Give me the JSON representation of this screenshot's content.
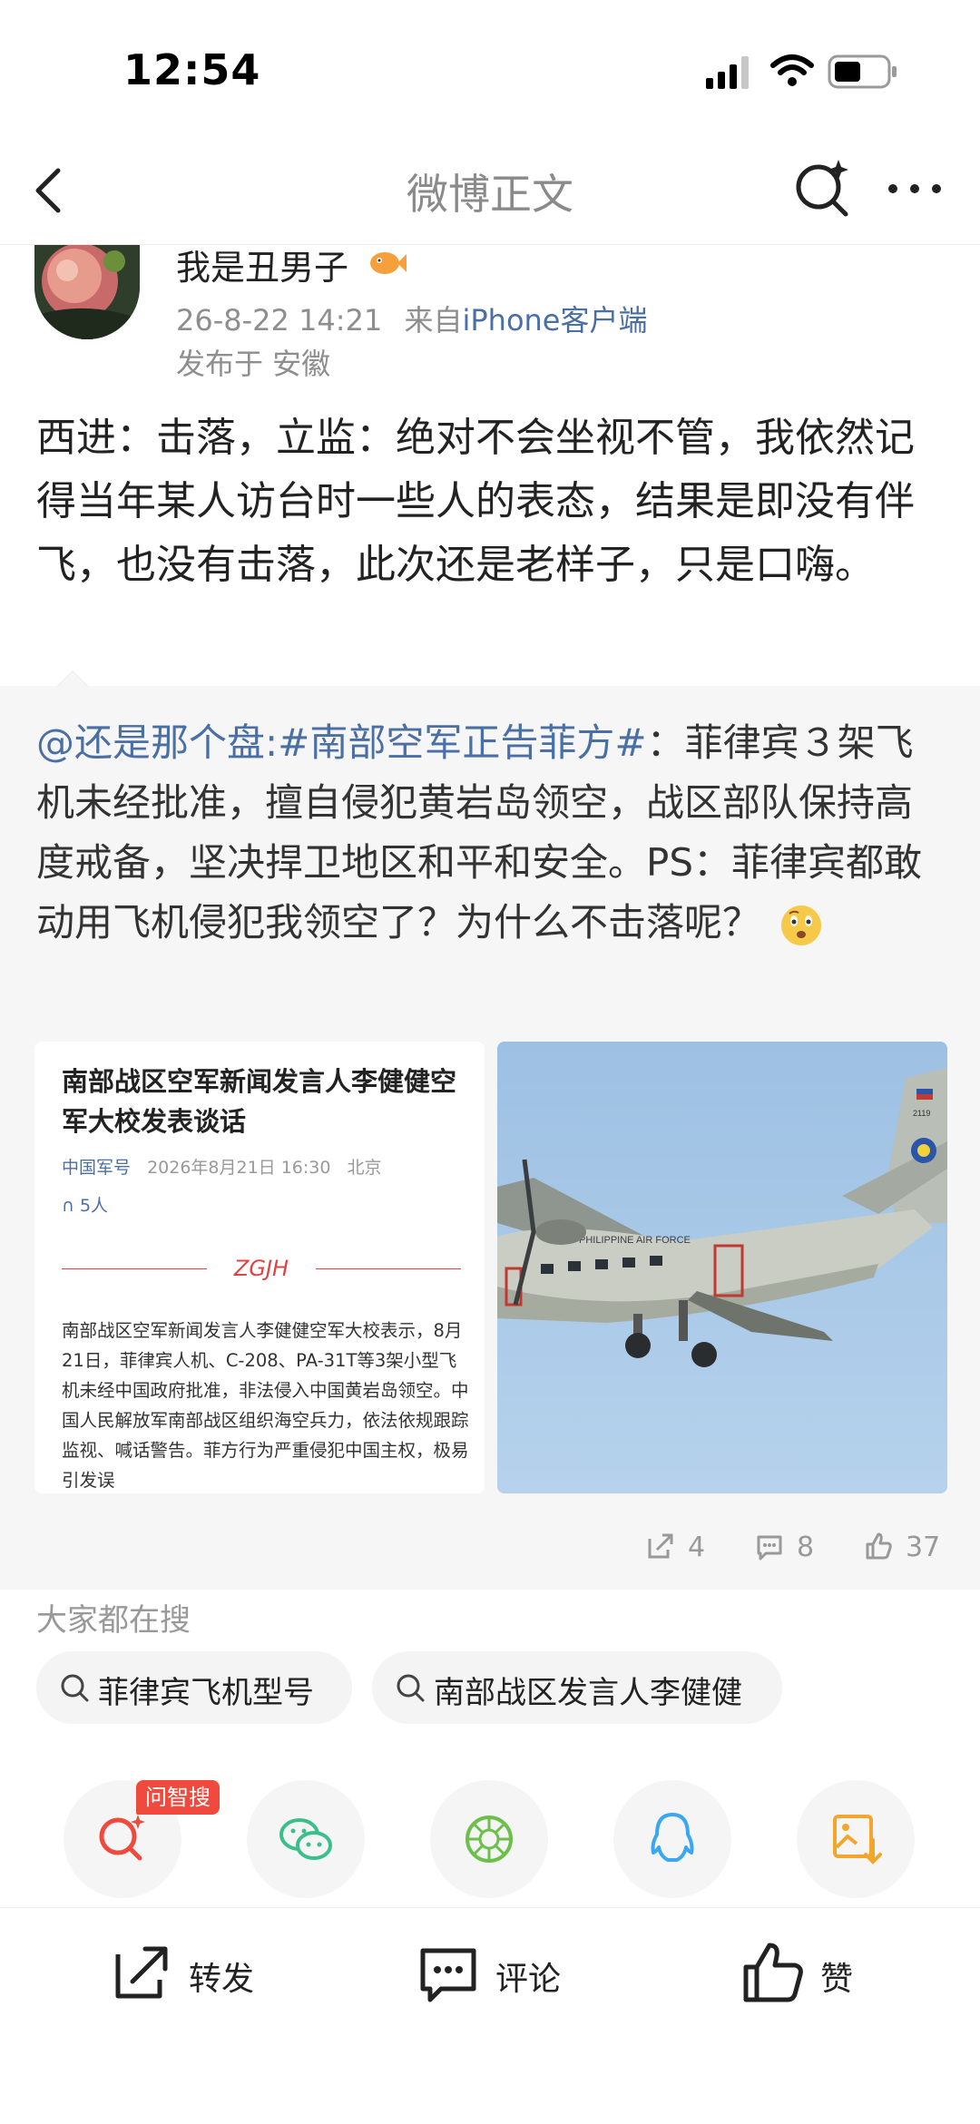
{
  "status_bar": {
    "time": "12:54"
  },
  "nav": {
    "title": "微博正文",
    "icons": [
      "back-arrow-icon",
      "search-sparkle-icon",
      "more-icon"
    ]
  },
  "author": {
    "name": "我是丑男子",
    "timestamp": "26-8-22 14:21",
    "source_prefix": "来自",
    "source": "iPhone客户端",
    "location": "发布于 安徽"
  },
  "post": {
    "text": "西进：击落，立监：绝对不会坐视不管，我依然记得当年某人访台时一些人的表态，结果是即没有伴飞，也没有击落，此次还是老样子，只是口嗨。"
  },
  "repost": {
    "user_link": "@还是那个盘",
    "separator": ":",
    "topic": "#南部空军正告菲方#",
    "text": "：菲律宾３架飞机未经批准，擅自侵犯黄岩岛领空，战区部队保持高度戒备，坚决捍卫地区和平和安全。PS：菲律宾都敢动用飞机侵犯我领空了？为什么不击落呢？",
    "emoji": "thinking-face-icon",
    "image_1": {
      "title": "南部战区空军新闻发言人李健健空军大校发表谈话",
      "org": "中国军号",
      "date": "2026年8月21日 16:30",
      "place": "北京",
      "listeners": "5人",
      "logo": "ZGJH",
      "body": "南部战区空军新闻发言人李健健空军大校表示，8月21日，菲律宾人机、C-208、PA-31T等3架小型飞机未经中国政府批准，非法侵入中国黄岩岛领空。中国人民解放军南部战区组织海空兵力，依法依规跟踪监视、喊话警告。菲方行为严重侵犯中国主权，极易引发误"
    },
    "image_2": {
      "plane_text": "PHILIPPINE AIR FORCE",
      "tail_number": "2119"
    },
    "actions": {
      "forwards": "4",
      "comments": "8",
      "likes": "37"
    }
  },
  "search": {
    "heading": "大家都在搜",
    "chips": [
      "菲律宾飞机型号",
      "南部战区发言人李健健"
    ]
  },
  "share": {
    "ai_badge": "问智搜",
    "targets": [
      "ai-search-icon",
      "wechat-icon",
      "moments-icon",
      "qq-icon",
      "save-image-icon"
    ]
  },
  "toolbar": {
    "forward": "转发",
    "comment": "评论",
    "like": "赞"
  },
  "colors": {
    "link": "#4a6fa5",
    "muted": "#8e8e8e",
    "badge": "#f04a3e",
    "wechat": "#3bbf8a",
    "qq": "#3aa7f0",
    "save": "#f2a62b"
  }
}
